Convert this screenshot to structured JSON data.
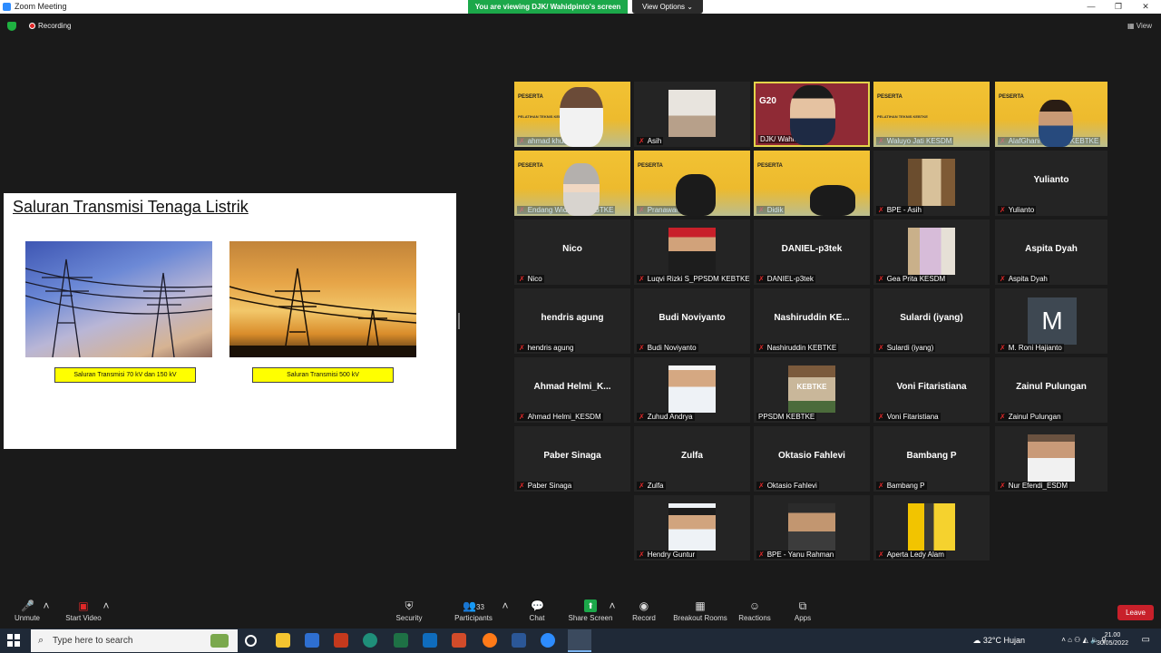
{
  "window": {
    "title": "Zoom Meeting",
    "minimize": "—",
    "restore": "❐",
    "close": "✕"
  },
  "banner": {
    "viewing": "You are viewing DJK/ Wahidpinto's screen",
    "view_options": "View Options ⌄"
  },
  "status": {
    "recording": "Recording",
    "view": "View"
  },
  "slide": {
    "title": "Saluran Transmisi Tenaga Listrik",
    "captions": [
      "Saluran Transmisi 70 kV dan 150 kV",
      "Saluran Transmisi 500 kV"
    ]
  },
  "banner_texts": {
    "peserta": "PESERTA",
    "pelatihan": "PELATIHAN TEKNIS KEBTKE"
  },
  "participants": [
    {
      "label": "ahmad khulaemi",
      "display": ""
    },
    {
      "label": "Asih",
      "display": ""
    },
    {
      "label": "DJK/ Wahidpinto",
      "display": ""
    },
    {
      "label": "Waluyo Jati KESDM",
      "display": ""
    },
    {
      "label": "AlafGhani PPSDM KEBTKE",
      "display": ""
    },
    {
      "label": "Endang Widayati-KEBTKE",
      "display": ""
    },
    {
      "label": "Pranawaningtyas",
      "display": ""
    },
    {
      "label": "Didik",
      "display": ""
    },
    {
      "label": "BPE - Asih",
      "display": ""
    },
    {
      "label": "Yulianto",
      "display": "Yulianto"
    },
    {
      "label": "Nico",
      "display": "Nico"
    },
    {
      "label": "Luqvi Rizki S_PPSDM KEBTKE",
      "display": ""
    },
    {
      "label": "DANIEL-p3tek",
      "display": "DANIEL-p3tek"
    },
    {
      "label": "Gea Prita KESDM",
      "display": ""
    },
    {
      "label": "Aspita Dyah",
      "display": "Aspita Dyah"
    },
    {
      "label": "hendris agung",
      "display": "hendris agung"
    },
    {
      "label": "Budi Noviyanto",
      "display": "Budi Noviyanto"
    },
    {
      "label": "Nashiruddin KEBTKE",
      "display": "Nashiruddin  KE..."
    },
    {
      "label": "Sulardi (iyang)",
      "display": "Sulardi (iyang)"
    },
    {
      "label": "M. Roni Hajianto",
      "display": "",
      "avatar": "M"
    },
    {
      "label": "Ahmad Helmi_KESDM",
      "display": "Ahmad  Helmi_K..."
    },
    {
      "label": "Zuhud Andrya",
      "display": ""
    },
    {
      "label": "PPSDM KEBTKE",
      "display": "",
      "logo": "KEBTKE"
    },
    {
      "label": "Voni Fitaristiana",
      "display": "Voni Fitaristiana"
    },
    {
      "label": "Zainul Pulungan",
      "display": "Zainul Pulungan"
    },
    {
      "label": "Paber Sinaga",
      "display": "Paber Sinaga"
    },
    {
      "label": "Zulfa",
      "display": "Zulfa"
    },
    {
      "label": "Oktasio Fahlevi",
      "display": "Oktasio Fahlevi"
    },
    {
      "label": "Bambang P",
      "display": "Bambang P"
    },
    {
      "label": "Nur Efendi_ESDM",
      "display": ""
    },
    {
      "label": "Hendry Guntur",
      "display": ""
    },
    {
      "label": "BPE - Yanu Rahman",
      "display": ""
    },
    {
      "label": "Aperta Ledy Alam",
      "display": ""
    }
  ],
  "toolbar": {
    "unmute": "Unmute",
    "start_video": "Start Video",
    "security": "Security",
    "participants": "Participants",
    "participants_count": "33",
    "chat": "Chat",
    "share": "Share Screen",
    "record": "Record",
    "breakout": "Breakout Rooms",
    "reactions": "Reactions",
    "apps": "Apps",
    "leave": "Leave"
  },
  "taskbar": {
    "search_placeholder": "Type here to search",
    "weather": "32°C  Hujan",
    "time": "21.00",
    "date": "30/05/2022"
  },
  "colors": {
    "share_green": "#1ca84a",
    "leave_red": "#c8202a",
    "banner_yellow": "#f2c233"
  }
}
